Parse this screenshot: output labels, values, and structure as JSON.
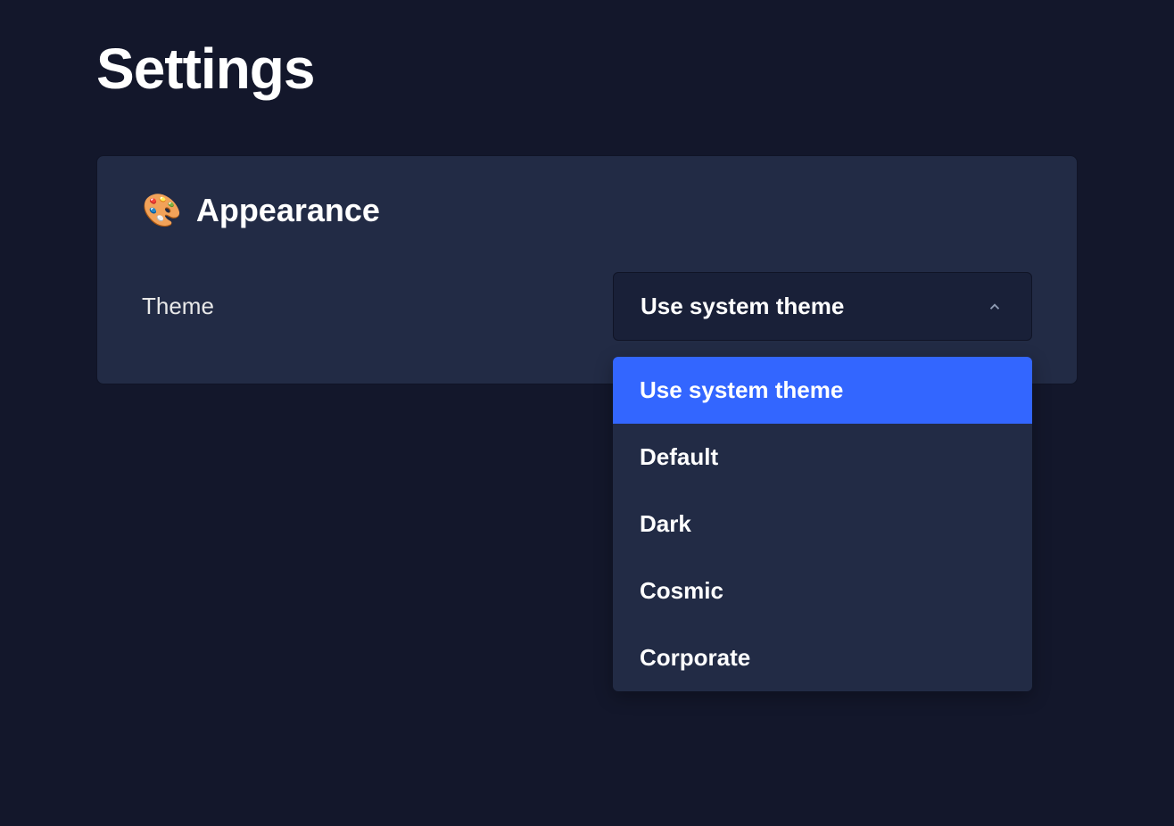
{
  "page": {
    "title": "Settings"
  },
  "appearance": {
    "icon": "🎨",
    "title": "Appearance",
    "theme": {
      "label": "Theme",
      "selected": "Use system theme",
      "options": [
        "Use system theme",
        "Default",
        "Dark",
        "Cosmic",
        "Corporate"
      ]
    }
  }
}
